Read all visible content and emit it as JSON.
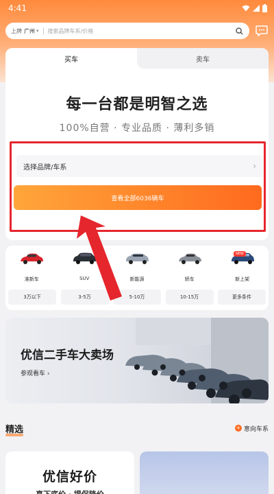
{
  "status_bar": {
    "time": "4:41"
  },
  "header": {
    "city_primary": "上牌",
    "city_secondary": "广州",
    "search_placeholder": "搜索品牌车系/价格"
  },
  "tabs": [
    {
      "label": "买车",
      "active": true
    },
    {
      "label": "卖车",
      "active": false
    }
  ],
  "hero": {
    "headline": "每一台都是明智之选",
    "subline": "100%自营 · 专业品质 · 薄利多销",
    "brand_select_label": "选择品牌/车系",
    "cta_label": "查看全部6036辆车"
  },
  "categories": [
    {
      "label": "准新车",
      "icon": "red-car-icon",
      "color": "#d9262c"
    },
    {
      "label": "SUV",
      "icon": "dark-suv-icon",
      "color": "#2b2f36"
    },
    {
      "label": "新能源",
      "icon": "silver-ev-icon",
      "color": "#9aa4b2"
    },
    {
      "label": "轿车",
      "icon": "grey-sedan-icon",
      "color": "#8a9099"
    },
    {
      "label": "新上架",
      "icon": "blue-suv-icon",
      "color": "#2c4a7a",
      "badge": "NEW"
    }
  ],
  "price_chips": [
    "3万以下",
    "3-5万",
    "5-10万",
    "10-15万",
    "更多条件"
  ],
  "banner": {
    "title": "优信二手车大卖场",
    "link_label": "参观看车 ›"
  },
  "section": {
    "title": "精选",
    "link_label": "意向车系"
  },
  "promo": {
    "title": "优信好价",
    "subline": "真下底价 · 提保降价"
  },
  "colors": {
    "accent": "#ff6a1e",
    "highlight_red": "#e5262d"
  }
}
